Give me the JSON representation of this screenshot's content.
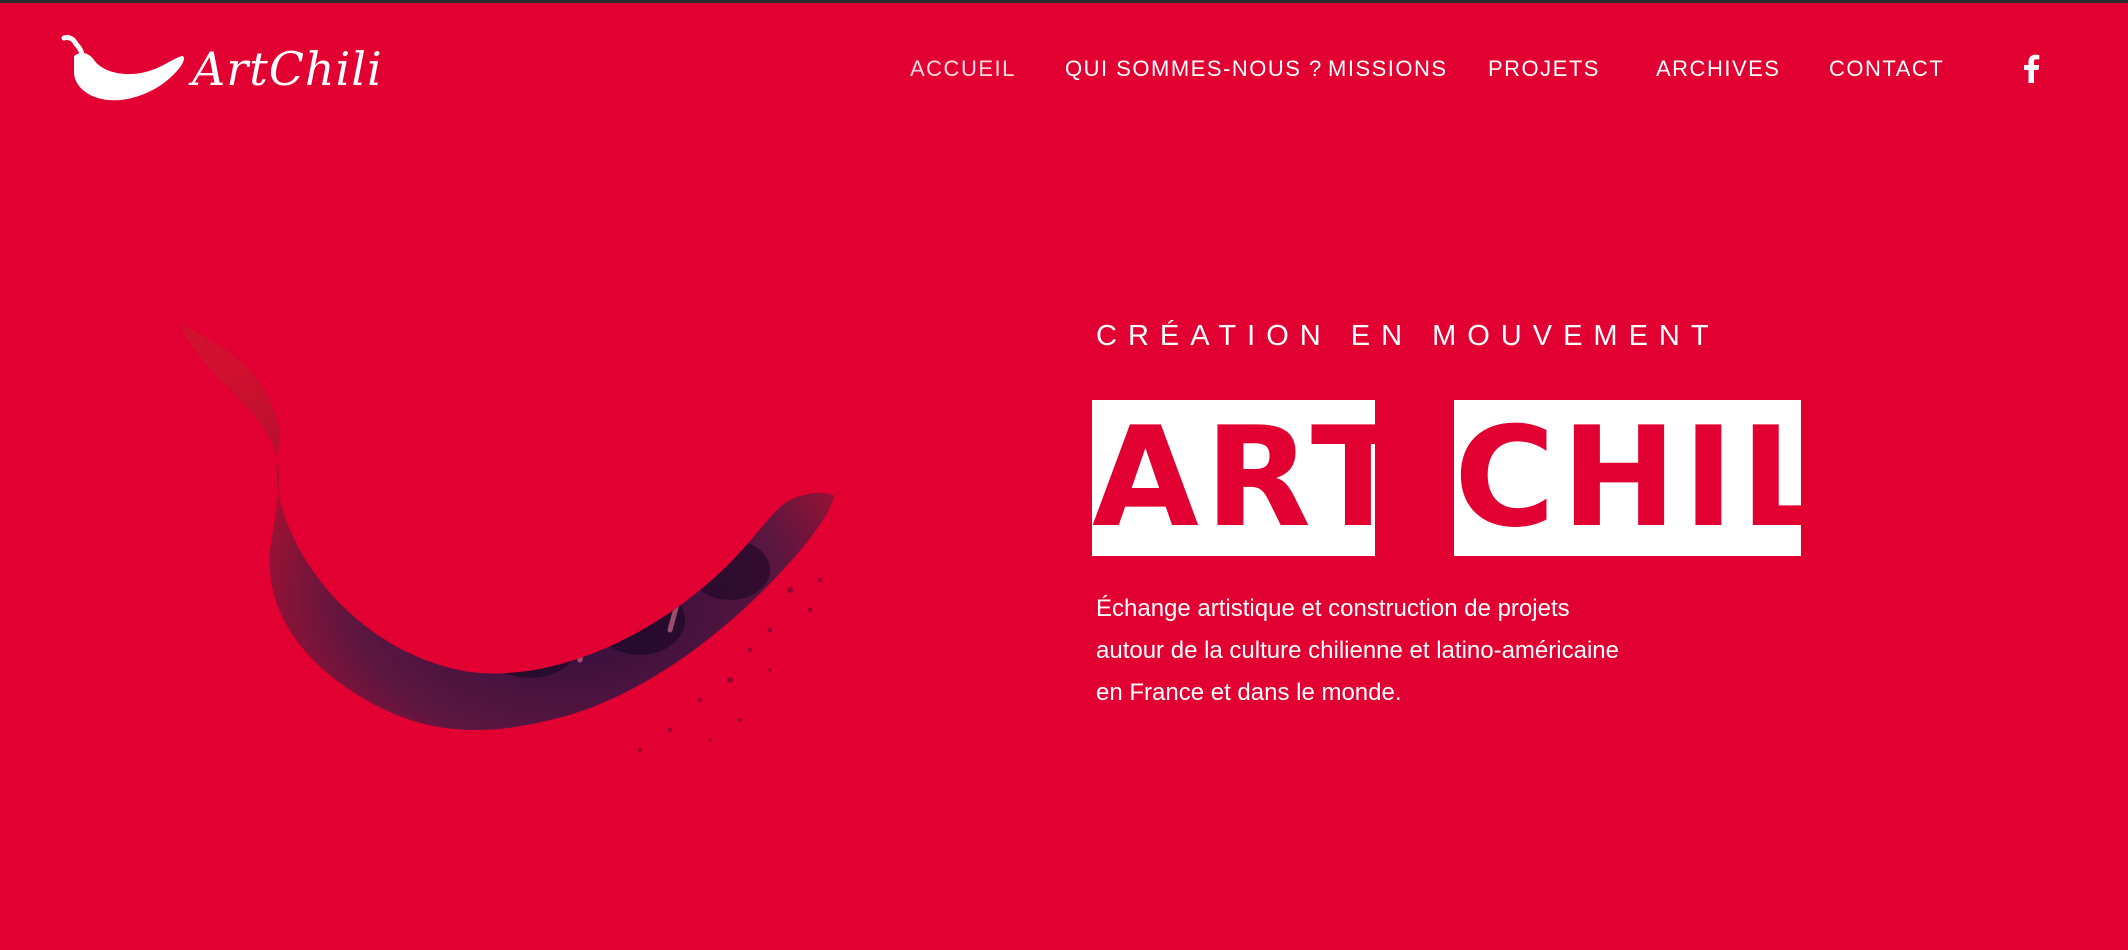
{
  "colors": {
    "background": "#e10031",
    "text": "#ffffff",
    "accent_box_text": "#e10031"
  },
  "header": {
    "logo_text": "ArtChili",
    "logo_icon": "chili-pepper-icon",
    "nav": [
      {
        "label": "ACCUEIL",
        "active": true
      },
      {
        "label": "QUI SOMMES-NOUS ?",
        "active": false
      },
      {
        "label": "MISSIONS",
        "active": false
      },
      {
        "label": "PROJETS",
        "active": false
      },
      {
        "label": "ARCHIVES",
        "active": false
      },
      {
        "label": "CONTACT",
        "active": false
      }
    ],
    "social_icon": "facebook-icon"
  },
  "hero": {
    "kicker": "CRÉATION EN MOUVEMENT",
    "title_word_1": "ART",
    "title_word_2": "CHILI",
    "description_lines": [
      "Échange artistique et construction de projets",
      "autour de la culture chilienne et latino-américaine",
      "en France et dans le monde."
    ],
    "image_icon": "chili-crowd-image"
  }
}
